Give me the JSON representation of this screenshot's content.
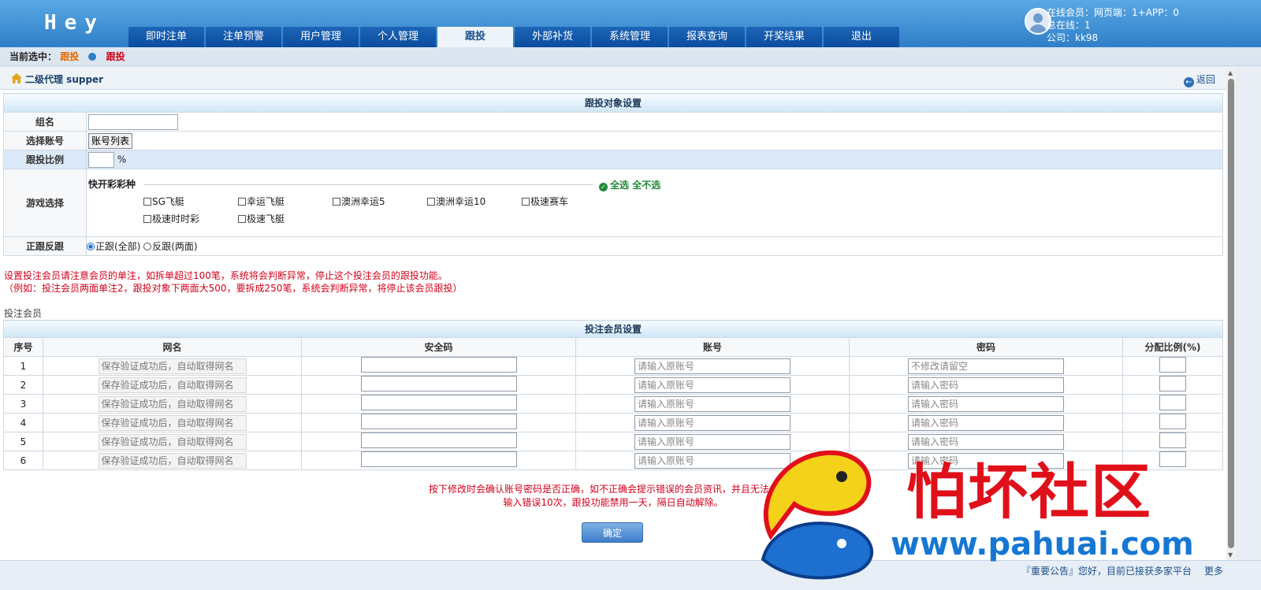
{
  "header": {
    "logo": "Hey",
    "tabs": [
      {
        "label": "即时注单",
        "active": false
      },
      {
        "label": "注单预警",
        "active": false
      },
      {
        "label": "用户管理",
        "active": false
      },
      {
        "label": "个人管理",
        "active": false
      },
      {
        "label": "跟投",
        "active": true
      },
      {
        "label": "外部补货",
        "active": false
      },
      {
        "label": "系统管理",
        "active": false
      },
      {
        "label": "报表查询",
        "active": false
      },
      {
        "label": "开奖结果",
        "active": false
      },
      {
        "label": "退出",
        "active": false
      }
    ],
    "online": "在线会员：网页端：1+APP：0",
    "total_online": "总在线：1",
    "company": "公司：kk98"
  },
  "selected": {
    "label": "当前选中：",
    "crumb1": "跟投",
    "crumb2": "跟投"
  },
  "breadcrumb": {
    "text": "二级代理 supper",
    "back": "返回"
  },
  "settings": {
    "title": "跟投对象设置",
    "group_label": "组名",
    "account_label": "选择账号",
    "account_button": "账号列表",
    "ratio_label": "跟投比例",
    "ratio_unit": "%",
    "game_label": "游戏选择",
    "game_category": "快开彩彩种",
    "select_all": "全选",
    "select_none": "全不选",
    "games": [
      "SG飞艇",
      "幸运飞艇",
      "澳洲幸运5",
      "澳洲幸运10",
      "极速赛车",
      "极速时时彩",
      "极速飞艇"
    ],
    "direction_label": "正跟反跟",
    "direction_forward": "正跟(全部)",
    "direction_reverse": "反跟(两面)"
  },
  "note": {
    "line1": "设置投注会员请注意会员的单注，如拆单超过100笔，系统将会判断异常，停止这个投注会员的跟投功能。",
    "line2": "（例如：投注会员两面单注2，跟投对象下两面大500，要拆成250笔，系统会判断异常，将停止该会员跟投）"
  },
  "members": {
    "label": "投注会员",
    "title": "投注会员设置",
    "columns": [
      "序号",
      "网名",
      "安全码",
      "账号",
      "密码",
      "分配比例(%)"
    ],
    "rows": [
      {
        "no": "1",
        "name": "保存验证成功后，自动取得网名",
        "account_ph": "请输入原账号",
        "password_ph": "不修改请留空"
      },
      {
        "no": "2",
        "name": "保存验证成功后，自动取得网名",
        "account_ph": "请输入原账号",
        "password_ph": "请输入密码"
      },
      {
        "no": "3",
        "name": "保存验证成功后，自动取得网名",
        "account_ph": "请输入原账号",
        "password_ph": "请输入密码"
      },
      {
        "no": "4",
        "name": "保存验证成功后，自动取得网名",
        "account_ph": "请输入原账号",
        "password_ph": "请输入密码"
      },
      {
        "no": "5",
        "name": "保存验证成功后，自动取得网名",
        "account_ph": "请输入原账号",
        "password_ph": "请输入密码"
      },
      {
        "no": "6",
        "name": "保存验证成功后，自动取得网名",
        "account_ph": "请输入原账号",
        "password_ph": "请输入密码"
      }
    ]
  },
  "warning": {
    "line1": "按下修改时会确认账号密码是否正确，如不正确会提示错误的会员资讯，并且无法保存。",
    "line2": "输入错误10次，跟投功能禁用一天，隔日自动解除。"
  },
  "confirm_label": "确定",
  "footer": {
    "ticker": "『重要公告』您好，目前已接获多家平台",
    "more": "更多"
  },
  "watermark": {
    "text": "怕坏社区",
    "url": "www.pahuai.com"
  },
  "colors": {
    "header_blue": "#2f7fc8",
    "accent_red": "#d0021b",
    "accent_green": "#1f8a3a"
  }
}
